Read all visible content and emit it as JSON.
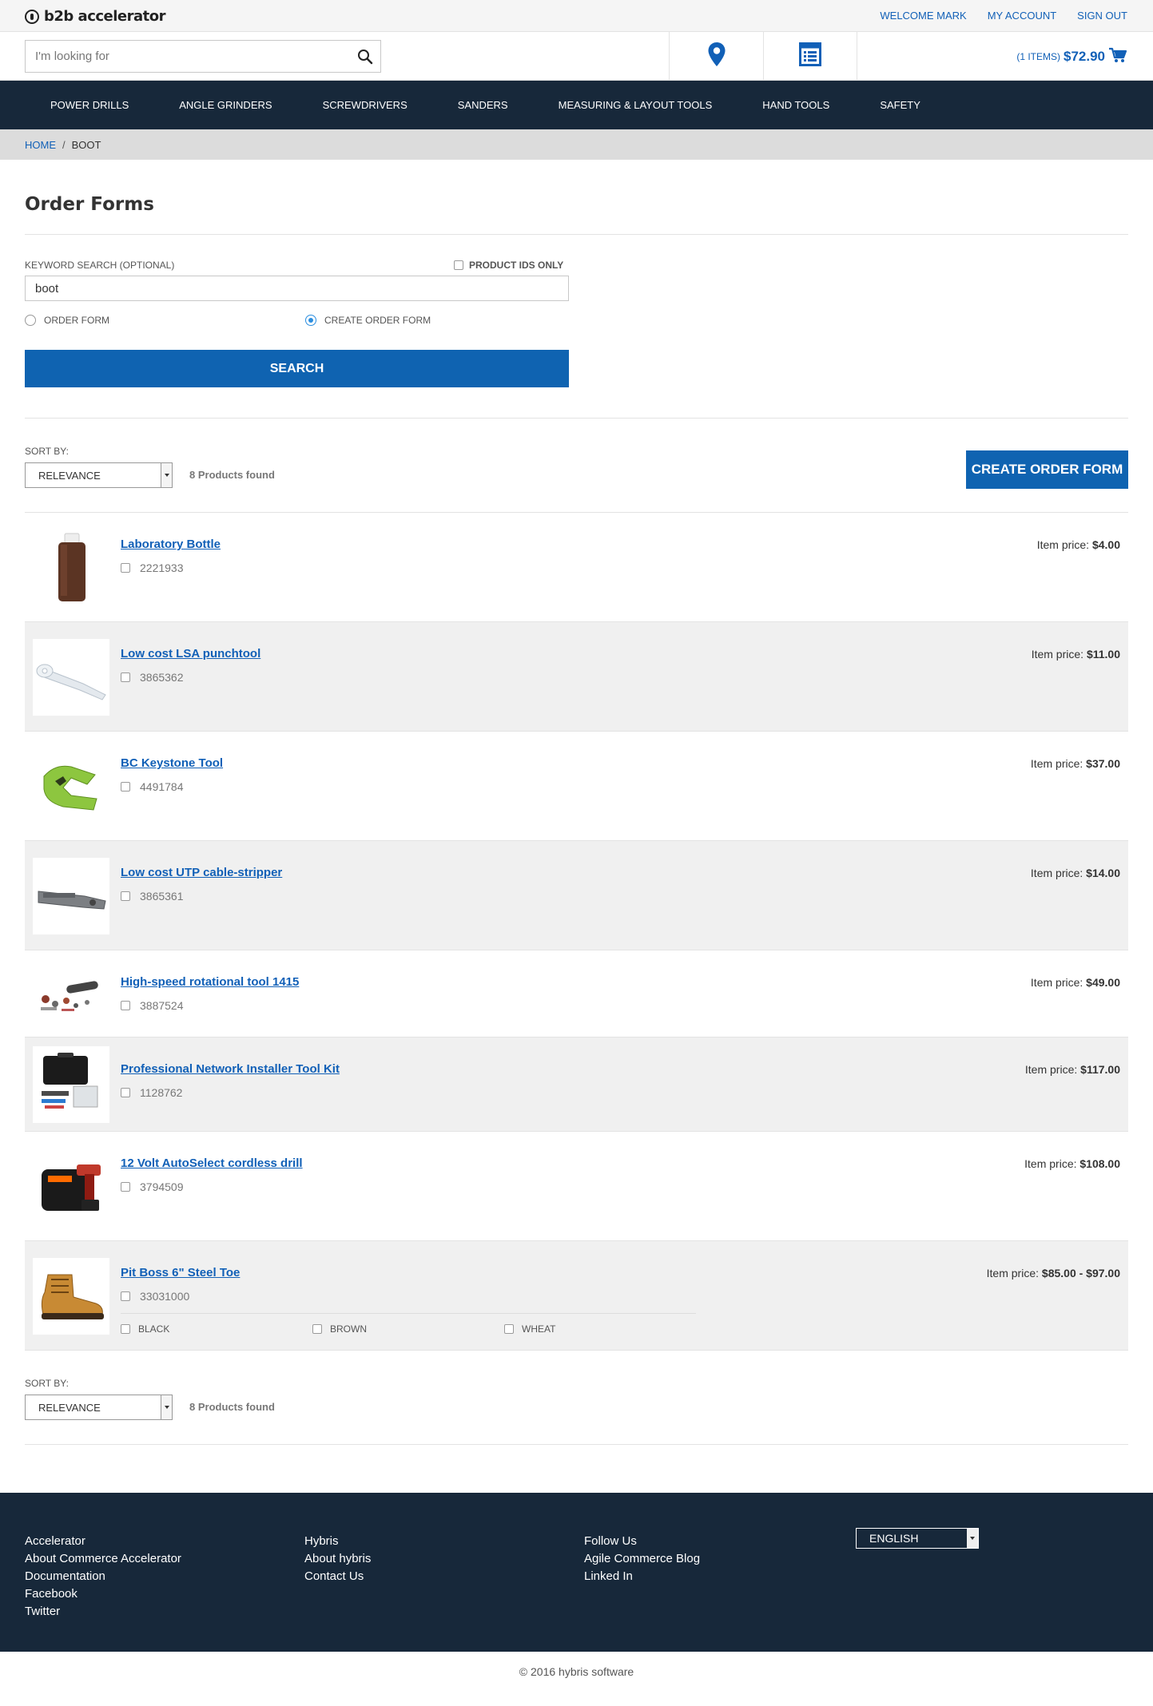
{
  "brand": {
    "name": "b2b accelerator"
  },
  "top_links": [
    {
      "label": "WELCOME MARK"
    },
    {
      "label": "MY ACCOUNT"
    },
    {
      "label": "SIGN OUT"
    }
  ],
  "search": {
    "placeholder": "I'm looking for",
    "icon": "search-icon"
  },
  "header_icons": {
    "locator": "map-pin-icon",
    "order_forms": "list-form-icon"
  },
  "cart": {
    "items": "(1 ITEMS)",
    "total": "$72.90",
    "icon": "cart-icon"
  },
  "nav": [
    {
      "label": "POWER DRILLS"
    },
    {
      "label": "ANGLE GRINDERS"
    },
    {
      "label": "SCREWDRIVERS"
    },
    {
      "label": "SANDERS"
    },
    {
      "label": "MEASURING & LAYOUT TOOLS"
    },
    {
      "label": "HAND TOOLS"
    },
    {
      "label": "SAFETY"
    }
  ],
  "breadcrumb": {
    "home": "HOME",
    "separator": "/",
    "current": "BOOT"
  },
  "page": {
    "title": "Order Forms"
  },
  "form": {
    "keyword_label": "KEYWORD SEARCH (OPTIONAL)",
    "product_ids_label": "PRODUCT IDS ONLY",
    "keyword_value": "boot",
    "radio_order_form": "ORDER FORM",
    "radio_create_order_form": "CREATE ORDER FORM",
    "selected_radio": "CREATE ORDER FORM",
    "search_button": "SEARCH"
  },
  "sort": {
    "label": "SORT BY:",
    "selected": "RELEVANCE",
    "found": "8 Products found",
    "create_button": "CREATE ORDER FORM"
  },
  "price_label": "Item price:",
  "products": [
    {
      "name": "Laboratory Bottle",
      "code": "2221933",
      "price": "$4.00"
    },
    {
      "name": "Low cost LSA punchtool",
      "code": "3865362",
      "price": "$11.00"
    },
    {
      "name": "BC Keystone Tool",
      "code": "4491784",
      "price": "$37.00"
    },
    {
      "name": "Low cost UTP cable-stripper",
      "code": "3865361",
      "price": "$14.00"
    },
    {
      "name": "High-speed rotational tool 1415",
      "code": "3887524",
      "price": "$49.00"
    },
    {
      "name": "Professional Network Installer Tool Kit",
      "code": "1128762",
      "price": "$117.00"
    },
    {
      "name": "12 Volt AutoSelect cordless drill",
      "code": "3794509",
      "price": "$108.00"
    },
    {
      "name": "Pit Boss 6\" Steel Toe",
      "code": "33031000",
      "price": "$85.00 - $97.00",
      "variants": [
        "BLACK",
        "BROWN",
        "WHEAT"
      ]
    }
  ],
  "footer": {
    "col1": [
      "Accelerator",
      "About Commerce Accelerator",
      "Documentation",
      "Facebook",
      "Twitter"
    ],
    "col2": [
      "Hybris",
      "About hybris",
      "Contact Us"
    ],
    "col3": [
      "Follow Us",
      "Agile Commerce Blog",
      "Linked In"
    ],
    "language": "ENGLISH",
    "copyright": "© 2016 hybris software"
  },
  "colors": {
    "accent": "#0f63b1",
    "link": "#1160b7",
    "nav_bg": "#17283a"
  }
}
